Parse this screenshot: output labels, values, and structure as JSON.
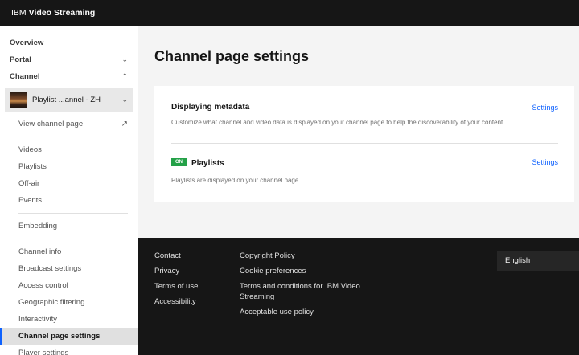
{
  "topbar": {
    "brand_prefix": "IBM",
    "brand_name": "Video Streaming"
  },
  "sidebar": {
    "overview": "Overview",
    "portal": "Portal",
    "channel": "Channel",
    "channel_selector": "Playlist ...annel - ZH",
    "view_channel_page": "View channel page",
    "group1": [
      "Videos",
      "Playlists",
      "Off-air",
      "Events"
    ],
    "embedding": "Embedding",
    "group2": [
      "Channel info",
      "Broadcast settings",
      "Access control",
      "Geographic filtering",
      "Interactivity",
      "Channel page settings",
      "Player settings"
    ]
  },
  "main": {
    "title": "Channel page settings",
    "metadata": {
      "title": "Displaying metadata",
      "description": "Customize what channel and video data is displayed on your channel page to help the discoverability of your content.",
      "link": "Settings"
    },
    "playlists": {
      "badge": "ON",
      "title": "Playlists",
      "description": "Playlists are displayed on your channel page.",
      "link": "Settings"
    }
  },
  "footer": {
    "col1": [
      "Contact",
      "Privacy",
      "Terms of use",
      "Accessibility"
    ],
    "col2": [
      "Copyright Policy",
      "Cookie preferences",
      "Terms and conditions for IBM Video Streaming",
      "Acceptable use policy"
    ],
    "language": "English"
  },
  "colors": {
    "accent": "#0f62fe",
    "on_badge": "#24a148",
    "topbar": "#161616"
  }
}
